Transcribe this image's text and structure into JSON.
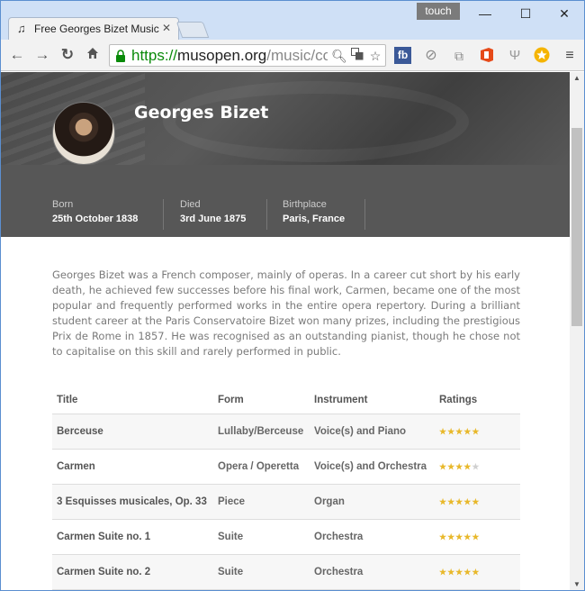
{
  "browser": {
    "tab_title": "Free Georges Bizet Music",
    "touch_label": "touch",
    "url": {
      "scheme": "https://",
      "host": "musopen.org",
      "path": "/music/composer/georges-bizet/"
    },
    "colors": {
      "tabstrip": "#cfe0f6",
      "secure": "#0a8a0a"
    }
  },
  "composer": {
    "name": "Georges Bizet",
    "facts": [
      {
        "label": "Born",
        "value": "25th October 1838"
      },
      {
        "label": "Died",
        "value": "3rd June 1875"
      },
      {
        "label": "Birthplace",
        "value": "Paris, France"
      }
    ],
    "bio": "Georges Bizet was a French composer, mainly of operas. In a career cut short by his early death, he achieved few successes before his final work, Carmen, became one of the most popular and frequently performed works in the entire opera repertory. During a brilliant student career at the Paris Conservatoire Bizet won many prizes, including the prestigious Prix de Rome in 1857. He was recognised as an outstanding pianist, though he chose not to capitalise on this skill and rarely performed in public."
  },
  "works_table": {
    "headers": [
      "Title",
      "Form",
      "Instrument",
      "Ratings"
    ],
    "rows": [
      {
        "title": "Berceuse",
        "form": "Lullaby/Berceuse",
        "instrument": "Voice(s) and Piano",
        "rating": 5
      },
      {
        "title": "Carmen",
        "form": "Opera / Operetta",
        "instrument": "Voice(s) and Orchestra",
        "rating": 4
      },
      {
        "title": "3 Esquisses musicales, Op. 33",
        "form": "Piece",
        "instrument": "Organ",
        "rating": 5
      },
      {
        "title": "Carmen Suite no. 1",
        "form": "Suite",
        "instrument": "Orchestra",
        "rating": 5
      },
      {
        "title": "Carmen Suite no. 2",
        "form": "Suite",
        "instrument": "Orchestra",
        "rating": 5
      }
    ],
    "star_color": "#e8b82a"
  }
}
